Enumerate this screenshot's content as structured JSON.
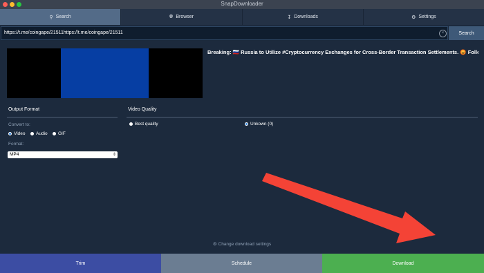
{
  "window": {
    "title": "SnapDownloader"
  },
  "tabs": [
    {
      "label": "Search",
      "icon": "search-icon"
    },
    {
      "label": "Browser",
      "icon": "globe-icon"
    },
    {
      "label": "Downloads",
      "icon": "download-icon"
    },
    {
      "label": "Settings",
      "icon": "gear-icon"
    }
  ],
  "url": {
    "value": "https://t.me/coingape/21511https://t.me/coingape/21511",
    "search_label": "Search"
  },
  "preview": {
    "headline": "Breaking: 🇷🇺 Russia to Utilize #Cryptocurrency Exchanges for Cross-Border Transaction Settlements. 😡 Follo..."
  },
  "output_format": {
    "heading": "Output Format",
    "convert_label": "Convert to:",
    "options": [
      "Video",
      "Audio",
      "GIF"
    ],
    "selected": "Video",
    "format_label": "Format:",
    "format_value": "MP4"
  },
  "video_quality": {
    "heading": "Video Quality",
    "options": [
      "Best quality",
      "Unkown (0)"
    ],
    "selected": "Unkown (0)"
  },
  "change_settings_label": "Change download settings",
  "bottom": {
    "trim_label": "Trim",
    "schedule_label": "Schedule",
    "download_label": "Download"
  },
  "colors": {
    "background": "#1c2a3d",
    "active_tab": "#536b88",
    "trim": "#3c4da3",
    "schedule": "#6b7d92",
    "download": "#4caf50",
    "annotation_arrow": "#f44336"
  }
}
